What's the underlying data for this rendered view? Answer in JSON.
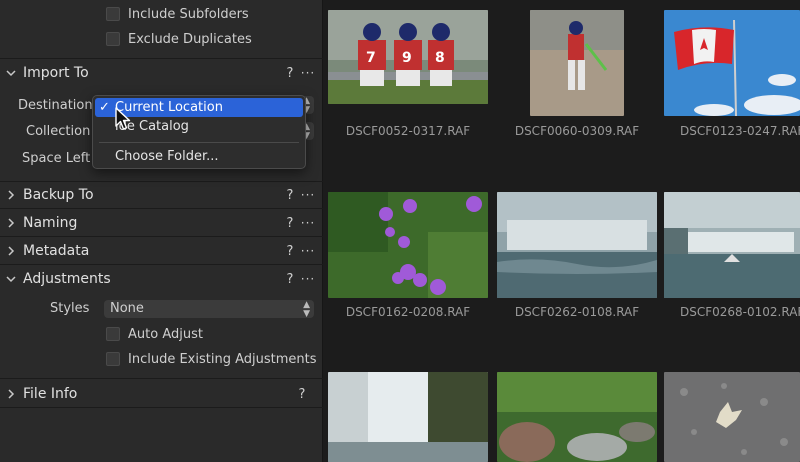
{
  "sidebar": {
    "source_options": [
      {
        "label": "Include Subfolders",
        "checked": false
      },
      {
        "label": "Exclude Duplicates",
        "checked": false
      }
    ],
    "import_to": {
      "title": "Import To",
      "help": "?",
      "more": "···",
      "destination_label": "Destination",
      "collection_label": "Collection",
      "space_left_label": "Space Left",
      "menu": {
        "items": [
          {
            "label": "Current Location",
            "selected": true,
            "check": "✓"
          },
          {
            "label": "Inside Catalog",
            "selected": false,
            "display": "ide Catalog"
          },
          {
            "label": "Choose Folder...",
            "selected": false
          }
        ]
      }
    },
    "sections": [
      {
        "id": "backup",
        "title": "Backup To",
        "help": "?",
        "more": "···",
        "expanded": false
      },
      {
        "id": "naming",
        "title": "Naming",
        "help": "?",
        "more": "···",
        "expanded": false
      },
      {
        "id": "metadata",
        "title": "Metadata",
        "help": "?",
        "more": "···",
        "expanded": false
      }
    ],
    "adjustments": {
      "title": "Adjustments",
      "help": "?",
      "more": "···",
      "styles_label": "Styles",
      "styles_value": "None",
      "options": [
        {
          "label": "Auto Adjust",
          "checked": false
        },
        {
          "label": "Include Existing Adjustments",
          "checked": false
        }
      ]
    },
    "file_info": {
      "title": "File Info",
      "help": "?"
    }
  },
  "grid": {
    "items": [
      {
        "filename": "DSCF0052-0317.RAF"
      },
      {
        "filename": "DSCF0060-0309.RAF"
      },
      {
        "filename": "DSCF0123-0247.RAF"
      },
      {
        "filename": "DSCF0162-0208.RAF"
      },
      {
        "filename": "DSCF0262-0108.RAF"
      },
      {
        "filename": "DSCF0268-0102.RAF"
      }
    ]
  },
  "colors": {
    "panel": "#2a2a2a",
    "grid_bg": "#1c1c1c",
    "accent": "#2b63d8"
  }
}
